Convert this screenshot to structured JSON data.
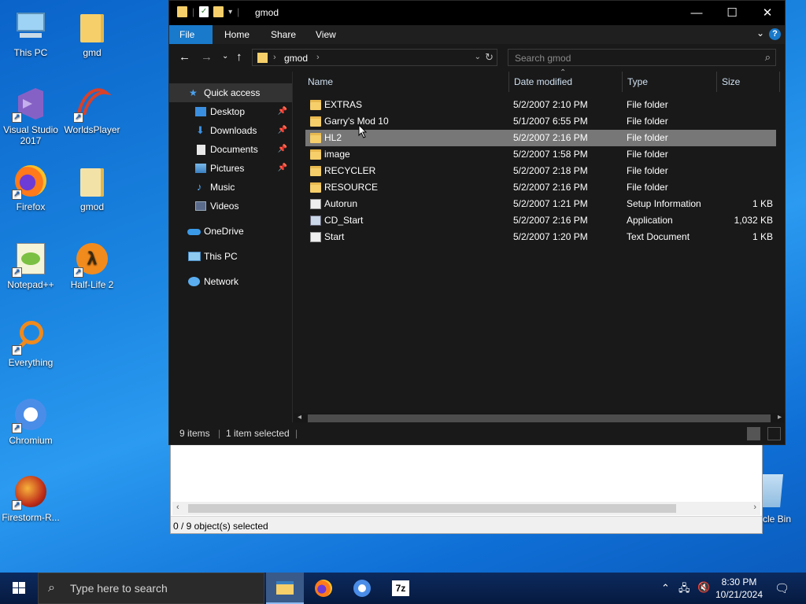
{
  "desktop": {
    "icons": [
      {
        "label": "This PC",
        "icon": "this-pc-icon"
      },
      {
        "label": "gmd",
        "icon": "folder-icon"
      },
      {
        "label": "Visual Studio 2017",
        "icon": "visual-studio-icon"
      },
      {
        "label": "WorldsPlayer",
        "icon": "worldsplayer-icon"
      },
      {
        "label": "Firefox",
        "icon": "firefox-icon"
      },
      {
        "label": "gmod",
        "icon": "folder-icon"
      },
      {
        "label": "Notepad++",
        "icon": "notepadpp-icon"
      },
      {
        "label": "Half-Life 2",
        "icon": "half-life-2-icon"
      },
      {
        "label": "Everything",
        "icon": "everything-icon"
      },
      {
        "label": "Chromium",
        "icon": "chromium-icon"
      },
      {
        "label": "Firestorm-R...",
        "icon": "firestorm-icon"
      }
    ],
    "recycle_label": "cle Bin"
  },
  "back_window": {
    "status": "0 / 9 object(s) selected"
  },
  "explorer": {
    "title": "gmod",
    "controls": {
      "minimize": "—",
      "maximize": "☐",
      "close": "✕"
    },
    "ribbon_tabs": [
      "File",
      "Home",
      "Share",
      "View"
    ],
    "address": {
      "crumb": "gmod"
    },
    "search_placeholder": "Search gmod",
    "nav": [
      {
        "label": "Quick access",
        "icon": "star-icon",
        "pinned": false
      },
      {
        "label": "Desktop",
        "icon": "desktop-icon",
        "pinned": true
      },
      {
        "label": "Downloads",
        "icon": "downloads-icon",
        "pinned": true
      },
      {
        "label": "Documents",
        "icon": "documents-icon",
        "pinned": true
      },
      {
        "label": "Pictures",
        "icon": "pictures-icon",
        "pinned": true
      },
      {
        "label": "Music",
        "icon": "music-icon",
        "pinned": false
      },
      {
        "label": "Videos",
        "icon": "videos-icon",
        "pinned": false
      },
      {
        "label": "OneDrive",
        "icon": "onedrive-icon",
        "pinned": false
      },
      {
        "label": "This PC",
        "icon": "this-pc-icon",
        "pinned": false
      },
      {
        "label": "Network",
        "icon": "network-icon",
        "pinned": false
      }
    ],
    "columns": [
      "Name",
      "Date modified",
      "Type",
      "Size"
    ],
    "files": [
      {
        "name": "EXTRAS",
        "date": "5/2/2007 2:10 PM",
        "type": "File folder",
        "size": "",
        "kind": "folder"
      },
      {
        "name": "Garry's Mod 10",
        "date": "5/1/2007 6:55 PM",
        "type": "File folder",
        "size": "",
        "kind": "folder"
      },
      {
        "name": "HL2",
        "date": "5/2/2007 2:16 PM",
        "type": "File folder",
        "size": "",
        "kind": "folder"
      },
      {
        "name": "image",
        "date": "5/2/2007 1:58 PM",
        "type": "File folder",
        "size": "",
        "kind": "folder"
      },
      {
        "name": "RECYCLER",
        "date": "5/2/2007 2:18 PM",
        "type": "File folder",
        "size": "",
        "kind": "folder"
      },
      {
        "name": "RESOURCE",
        "date": "5/2/2007 2:16 PM",
        "type": "File folder",
        "size": "",
        "kind": "folder"
      },
      {
        "name": "Autorun",
        "date": "5/2/2007 1:21 PM",
        "type": "Setup Information",
        "size": "1 KB",
        "kind": "doc"
      },
      {
        "name": "CD_Start",
        "date": "5/2/2007 2:16 PM",
        "type": "Application",
        "size": "1,032 KB",
        "kind": "app"
      },
      {
        "name": "Start",
        "date": "5/2/2007 1:20 PM",
        "type": "Text Document",
        "size": "1 KB",
        "kind": "doc"
      }
    ],
    "status": {
      "count": "9 items",
      "selected": "1 item selected"
    }
  },
  "taskbar": {
    "search_placeholder": "Type here to search",
    "apps": [
      "file-explorer-icon",
      "firefox-icon",
      "chromium-icon",
      "7zip-icon"
    ],
    "seven_zip_label": "7z",
    "time": "8:30 PM",
    "date": "10/21/2024"
  }
}
